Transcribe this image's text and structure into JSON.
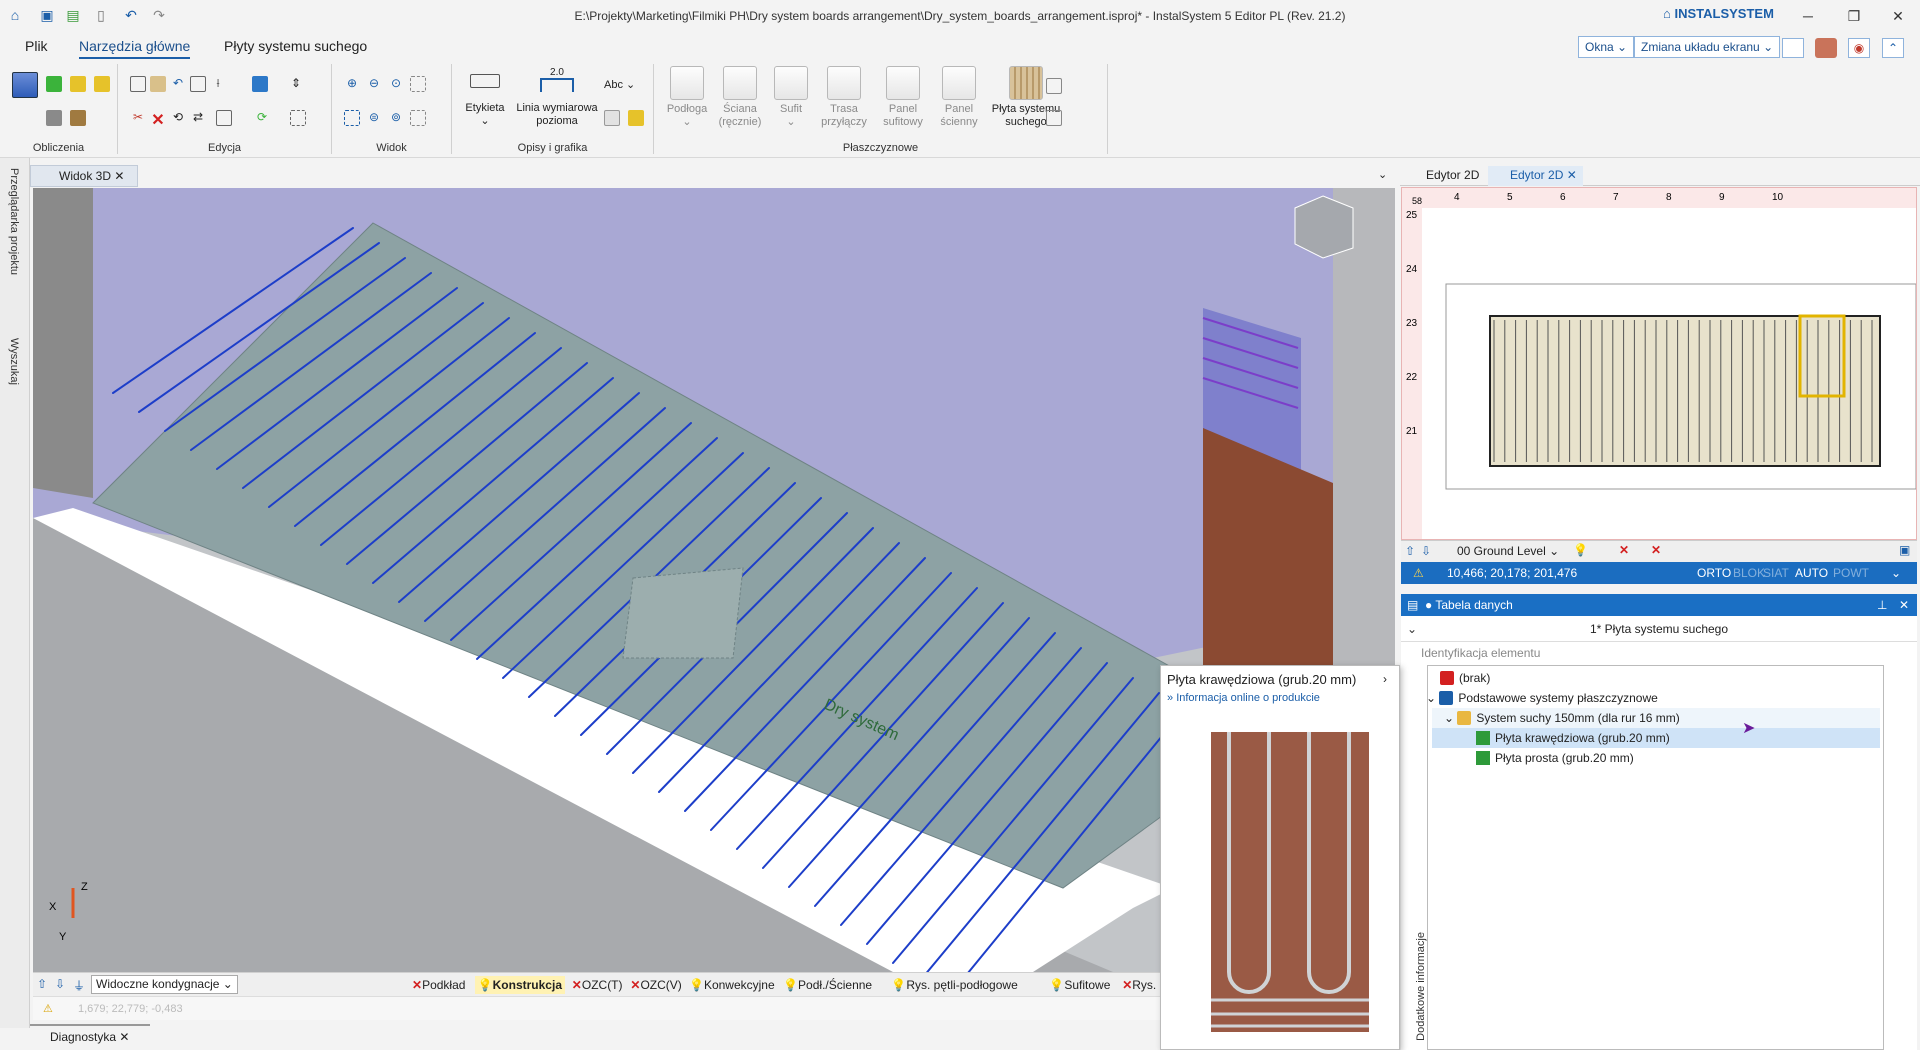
{
  "window": {
    "title": "E:\\Projekty\\Marketing\\Filmiki PH\\Dry system boards arrangement\\Dry_system_boards_arrangement.isproj* - InstalSystem 5 Editor PL (Rev. 21.2)",
    "brand": "INSTALSYSTEM"
  },
  "menu": {
    "tabs": [
      "Plik",
      "Narzędzia główne",
      "Płyty systemu suchego"
    ],
    "right_buttons": [
      "Okna",
      "Zmiana układu ekranu"
    ]
  },
  "ribbon": {
    "groups": [
      "Obliczenia",
      "Edycja",
      "Widok",
      "Opisy i grafika",
      "Płaszczyznowe"
    ],
    "opisy": {
      "etykieta": "Etykieta",
      "linia_line1": "Linia wymiarowa",
      "linia_line2": "pozioma",
      "dim_value": "2.0",
      "abc": "Abc"
    },
    "plaszczyznowe": [
      {
        "line1": "Podłoga",
        "line2": ""
      },
      {
        "line1": "Ściana",
        "line2": "(ręcznie)"
      },
      {
        "line1": "Sufit",
        "line2": ""
      },
      {
        "line1": "Trasa",
        "line2": "przyłączy"
      },
      {
        "line1": "Panel",
        "line2": "sufitowy"
      },
      {
        "line1": "Panel",
        "line2": "ścienny"
      },
      {
        "line1": "Płyta systemu",
        "line2": "suchego"
      }
    ]
  },
  "left_panel": {
    "project_browser": "Przeglądarka projektu",
    "search": "Wyszukaj"
  },
  "view3d": {
    "tab": "Widok 3D",
    "board_text": "Dry system",
    "axes": {
      "x": "X",
      "y": "Y",
      "z": "Z"
    },
    "levels_label": "Widoczne kondygnacje",
    "coords_hint": "1,679; 22,779; -0,483",
    "filters": [
      {
        "label": "Podkład",
        "type": "x"
      },
      {
        "label": "Konstrukcja",
        "type": "b",
        "active": true
      },
      {
        "label": "OZC(T)",
        "type": "x"
      },
      {
        "label": "OZC(V)",
        "type": "x"
      },
      {
        "label": "Konwekcyjne",
        "type": "b"
      },
      {
        "label": "Podł./Ścienne",
        "type": "b"
      },
      {
        "label": "Rys. pętli-podłogowe",
        "type": "b"
      },
      {
        "label": "Sufitowe",
        "type": "b"
      },
      {
        "label": "Rys. pęt",
        "type": "x"
      }
    ]
  },
  "diagnostics": {
    "tab": "Diagnostyka"
  },
  "editor2d": {
    "tabs": [
      "Edytor 2D",
      "Edytor 2D"
    ],
    "ruler_top": [
      "4",
      "5",
      "6",
      "7",
      "8",
      "9",
      "10"
    ],
    "ruler_left": [
      "25",
      "24",
      "23",
      "22",
      "21"
    ],
    "ruler_corner": "58",
    "level": "00 Ground Level",
    "status": {
      "coords": "10,466; 20,178; 201,476",
      "orto": "ORTO",
      "blok": "BLOK",
      "siat": "SIAT",
      "auto": "AUTO",
      "powt": "POWT"
    }
  },
  "data_table": {
    "header": "Tabela danych",
    "subtitle": "1* Płyta systemu suchego",
    "section": "Identyfikacja elementu",
    "side_label": "Dodatkowe informacje"
  },
  "popup": {
    "title": "Płyta krawędziowa (grub.20 mm)",
    "link": "Informacja online o produkcie"
  },
  "tree": {
    "items": [
      {
        "label": "(brak)",
        "icon": "red-x-icon",
        "level": 0
      },
      {
        "label": "Podstawowe systemy płaszczyznowe",
        "icon": "database-icon",
        "level": 0,
        "expander": "⌄"
      },
      {
        "label": "System suchy 150mm (dla rur 16 mm)",
        "icon": "folder-icon",
        "level": 1,
        "expander": "⌄"
      },
      {
        "label": "Płyta krawędziowa (grub.20 mm)",
        "icon": "component-icon",
        "level": 2,
        "selected": true
      },
      {
        "label": "Płyta prosta (grub.20 mm)",
        "icon": "component-icon",
        "level": 2
      }
    ]
  },
  "colors": {
    "accent": "#1b6dc0",
    "board": "#8fa3a3",
    "pipe": "#1d3ec9",
    "wall_purple": "#a7a5d6",
    "wall_brown": "#8b4a32"
  }
}
